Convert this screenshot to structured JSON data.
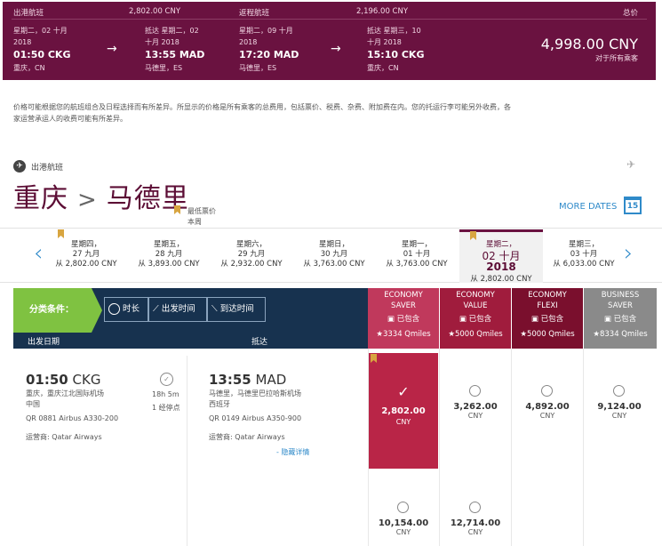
{
  "summary": {
    "outbound_label": "出港航班",
    "outbound_price": "2,802.00 CNY",
    "return_label": "返程航班",
    "return_price": "2,196.00 CNY",
    "total_label": "总价",
    "total": "4,998.00 CNY",
    "total_sub": "对于所有乘客",
    "legs": [
      {
        "date": "星期二，02 十月",
        "year": "2018",
        "time": "01:50 CKG",
        "place": "重庆，CN"
      },
      {
        "date": "抵达 星期二，02",
        "year": "十月 2018",
        "time": "13:55 MAD",
        "place": "马德里，ES"
      },
      {
        "date": "星期二，09 十月",
        "year": "2018",
        "time": "17:20 MAD",
        "place": "马德里，ES"
      },
      {
        "date": "抵达 星期三，10",
        "year": "十月 2018",
        "time": "15:10 CKG",
        "place": "重庆，CN"
      }
    ]
  },
  "notice": "价格可能根据您的航班组合及日程选择而有所差异。所显示的价格是所有乘客的总费用，包括票价、税费、杂费、附加费在内。您的托运行李可能另外收费，各家运营承运人的收费可能有所差异。",
  "outbound": {
    "label": "出港航班",
    "origin": "重庆",
    "separator": ">",
    "destination": "马德里",
    "lowest_label": "最低票价",
    "lowest_sub": "本周",
    "more_dates": "MORE DATES",
    "calendar_day": "15"
  },
  "dates": [
    {
      "d1": "星期四，",
      "d2": "27 九月",
      "price": "从 2,802.00 CNY"
    },
    {
      "d1": "星期五，",
      "d2": "28 九月",
      "price": "从 3,893.00 CNY"
    },
    {
      "d1": "星期六，",
      "d2": "29 九月",
      "price": "从 2,932.00 CNY"
    },
    {
      "d1": "星期日，",
      "d2": "30 九月",
      "price": "从 3,763.00 CNY"
    },
    {
      "d1": "星期一，",
      "d2": "01 十月",
      "price": "从 3,763.00 CNY"
    },
    {
      "d1": "星期二，",
      "d2": "02 十月",
      "d3": "2018",
      "price": "从 2,802.00 CNY"
    },
    {
      "d1": "星期三，",
      "d2": "03 十月",
      "price": "从 6,033.00 CNY"
    }
  ],
  "filter": {
    "label": "分类条件：",
    "duration": "时长",
    "depart_time": "出发时间",
    "arrive_time": "到达时间",
    "col_depart": "出发日期",
    "col_arrive": "抵达"
  },
  "cabins": [
    {
      "n1": "ECONOMY",
      "n2": "SAVER",
      "inc": "已包含",
      "q": "3334 Qmiles",
      "color": "#c0395c"
    },
    {
      "n1": "ECONOMY",
      "n2": "VALUE",
      "inc": "已包含",
      "q": "5000 Qmiles",
      "color": "#a01c3d"
    },
    {
      "n1": "ECONOMY",
      "n2": "FLEXI",
      "inc": "已包含",
      "q": "5000 Qmiles",
      "color": "#7a0f2d"
    },
    {
      "n1": "BUSINESS",
      "n2": "SAVER",
      "inc": "已包含",
      "q": "8334 Qmiles",
      "color": "#8a8a8a"
    }
  ],
  "flight": {
    "dep_time": "01:50",
    "dep_code": "CKG",
    "dep_airport": "重庆，重庆江北国际机场",
    "dep_country": "中国",
    "dep_flight": "QR 0881 Airbus A330-200",
    "dep_operator": "运营商: Qatar Airways",
    "duration": "18h 5m",
    "stops": "1 经停点",
    "arr_time": "13:55",
    "arr_code": "MAD",
    "arr_airport": "马德里，马德里巴拉哈斯机场",
    "arr_country": "西班牙",
    "arr_flight": "QR 0149 Airbus A350-900",
    "arr_operator": "运营商: Qatar Airways",
    "hide_details": "- 隐藏详情"
  },
  "fares": [
    {
      "amount": "2,802.00",
      "cur": "CNY"
    },
    {
      "amount": "3,262.00",
      "cur": "CNY"
    },
    {
      "amount": "4,892.00",
      "cur": "CNY"
    },
    {
      "amount": "9,124.00",
      "cur": "CNY"
    },
    {
      "amount": "10,154.00",
      "cur": "CNY"
    },
    {
      "amount": "12,714.00",
      "cur": "CNY"
    }
  ]
}
